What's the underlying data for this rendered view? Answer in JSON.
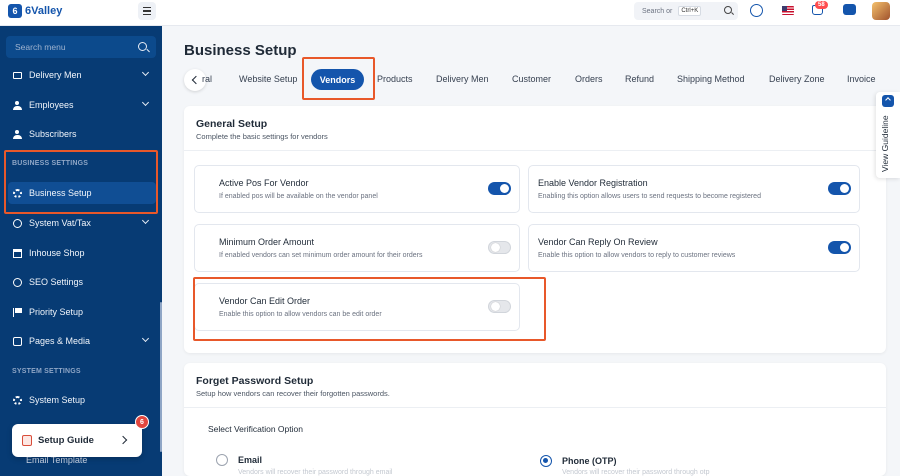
{
  "brand": {
    "name": "6Valley",
    "mark": "6",
    "primary_color": "#1455ac",
    "sidebar_color": "#073b74",
    "highlight_color": "#e8582a"
  },
  "topbar": {
    "search_placeholder": "Search or",
    "shortcut": "Ctrl+K",
    "cart_count": "58",
    "icons": [
      "menu-icon",
      "search-icon",
      "globe-icon",
      "us-flag-icon",
      "cart-icon",
      "message-icon",
      "avatar"
    ]
  },
  "sidebar": {
    "search_placeholder": "Search menu",
    "items": [
      {
        "label": "Delivery Men",
        "icon": "truck-icon",
        "expandable": true
      },
      {
        "label": "Employees",
        "icon": "person-icon",
        "expandable": true
      },
      {
        "label": "Subscribers",
        "icon": "person-icon",
        "expandable": false
      }
    ],
    "section_business": "BUSINESS SETTINGS",
    "business_items": [
      {
        "label": "Business Setup",
        "icon": "gear-icon",
        "active": true
      },
      {
        "label": "System Vat/Tax",
        "icon": "tax-icon",
        "expandable": true
      },
      {
        "label": "Inhouse Shop",
        "icon": "shop-icon"
      },
      {
        "label": "SEO Settings",
        "icon": "seo-icon"
      },
      {
        "label": "Priority Setup",
        "icon": "flag-icon"
      },
      {
        "label": "Pages & Media",
        "icon": "media-icon",
        "expandable": true
      }
    ],
    "section_system": "SYSTEM SETTINGS",
    "system_items": [
      {
        "label": "System Setup",
        "icon": "gear-icon"
      }
    ],
    "email_template": "Email Template",
    "setup_guide": {
      "label": "Setup Guide",
      "badge": "6"
    }
  },
  "page": {
    "title": "Business Setup"
  },
  "tabs": [
    "ral",
    "Website Setup",
    "Vendors",
    "Products",
    "Delivery Men",
    "Customer",
    "Orders",
    "Refund",
    "Shipping Method",
    "Delivery Zone",
    "Invoice"
  ],
  "active_tab": "Vendors",
  "general": {
    "title": "General Setup",
    "subtitle": "Complete the basic settings for vendors",
    "settings": [
      {
        "title": "Active Pos For Vendor",
        "desc": "If enabled pos will be available on the vendor panel",
        "enabled": true
      },
      {
        "title": "Enable Vendor Registration",
        "desc": "Enabling this option allows users to send requests to become registered",
        "enabled": true
      },
      {
        "title": "Minimum Order Amount",
        "desc": "If enabled vendors can set minimum order amount for their orders",
        "enabled": false
      },
      {
        "title": "Vendor Can Reply On Review",
        "desc": "Enable this option to allow vendors to reply to customer reviews",
        "enabled": true
      },
      {
        "title": "Vendor Can Edit Order",
        "desc": "Enable this option to allow vendors can be edit order",
        "enabled": false
      }
    ]
  },
  "forgot": {
    "title": "Forget Password Setup",
    "subtitle": "Setup how vendors can recover their forgotten passwords.",
    "select_label": "Select Verification Option",
    "options": [
      {
        "label": "Email",
        "hint": "Vendors will recover their password through email",
        "selected": false
      },
      {
        "label": "Phone (OTP)",
        "hint": "Vendors will recover their password through otp",
        "selected": true
      }
    ]
  },
  "guideline": {
    "label": "View Guideline"
  }
}
